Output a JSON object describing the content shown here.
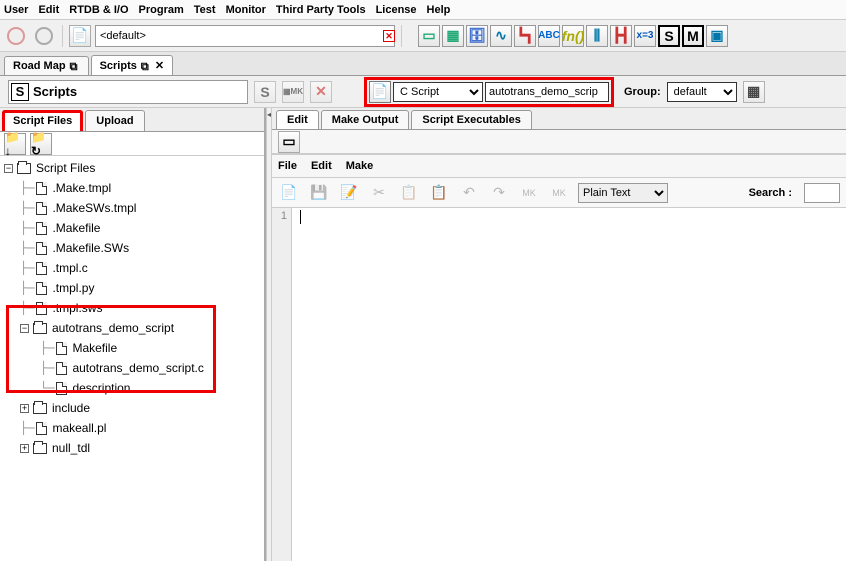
{
  "menubar": [
    "User",
    "Edit",
    "RTDB & I/O",
    "Program",
    "Test",
    "Monitor",
    "Third Party Tools",
    "License",
    "Help"
  ],
  "toolbar": {
    "default_value": "<default>"
  },
  "tabs": {
    "roadmap": "Road Map",
    "scripts": "Scripts"
  },
  "scripts_header": {
    "title": "Scripts",
    "ctype_label": "C Script",
    "name_input": "autotrans_demo_scrip",
    "group_label": "Group:",
    "group_value": "default"
  },
  "left_tabs": {
    "script_files": "Script Files",
    "upload": "Upload"
  },
  "tree": {
    "root": "Script Files",
    "items": [
      ".Make.tmpl",
      ".MakeSWs.tmpl",
      ".Makefile",
      ".Makefile.SWs",
      ".tmpl.c",
      ".tmpl.py",
      ".tmpl.sws"
    ],
    "folder": {
      "name": "autotrans_demo_script",
      "children": [
        "Makefile",
        "autotrans_demo_script.c",
        "description"
      ]
    },
    "after": [
      {
        "name": "include",
        "type": "folder"
      },
      {
        "name": "makeall.pl",
        "type": "file"
      },
      {
        "name": "null_tdl",
        "type": "folder"
      }
    ]
  },
  "right_tabs": [
    "Edit",
    "Make Output",
    "Script Executables"
  ],
  "editor_menus": [
    "File",
    "Edit",
    "Make"
  ],
  "editor": {
    "lang": "Plain Text",
    "search_label": "Search :",
    "line1": "1"
  }
}
